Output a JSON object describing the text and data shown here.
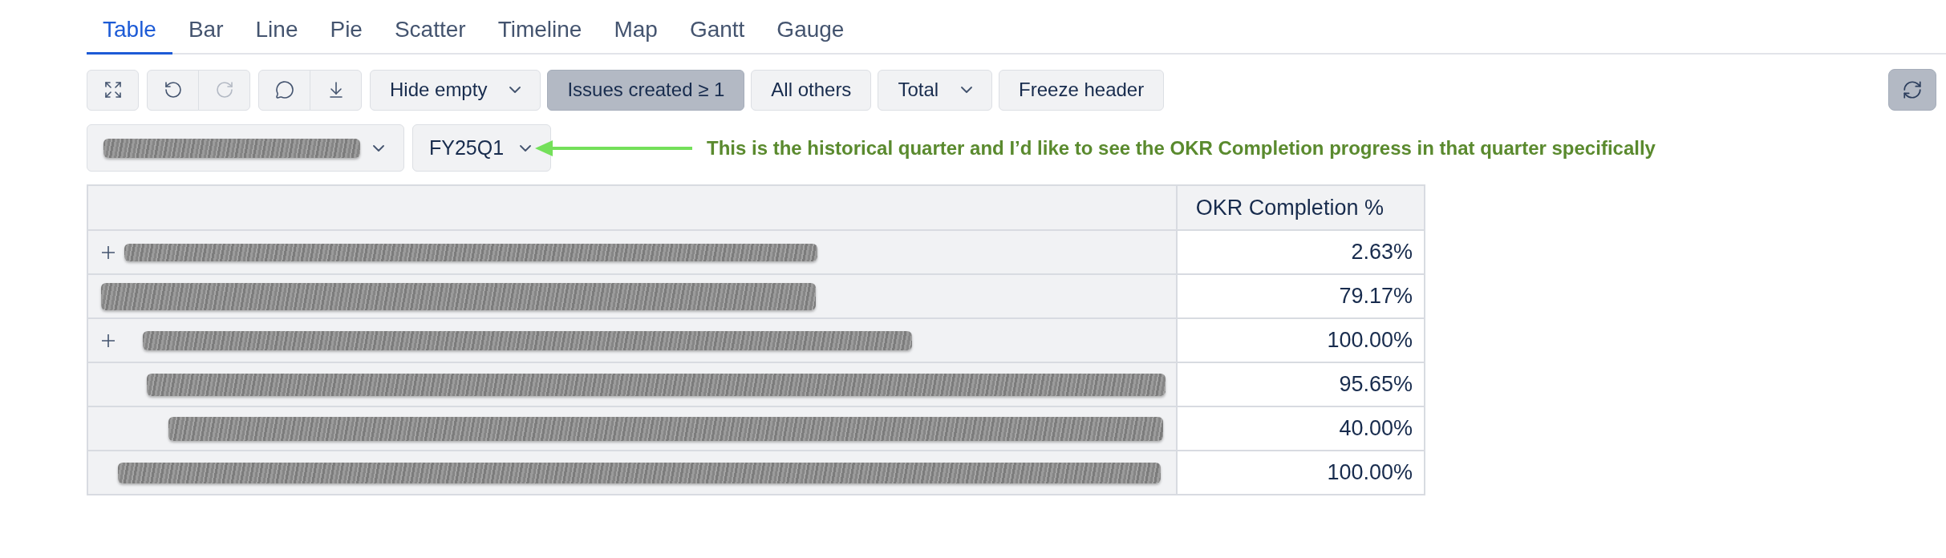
{
  "tabs": [
    {
      "label": "Table",
      "selected": true
    },
    {
      "label": "Bar",
      "selected": false
    },
    {
      "label": "Line",
      "selected": false
    },
    {
      "label": "Pie",
      "selected": false
    },
    {
      "label": "Scatter",
      "selected": false
    },
    {
      "label": "Timeline",
      "selected": false
    },
    {
      "label": "Map",
      "selected": false
    },
    {
      "label": "Gantt",
      "selected": false
    },
    {
      "label": "Gauge",
      "selected": false
    }
  ],
  "toolbar": {
    "icon_groups": [
      [
        {
          "kind": "expand",
          "disabled": false
        }
      ],
      [
        {
          "kind": "undo",
          "disabled": false
        },
        {
          "kind": "redo",
          "disabled": true
        }
      ],
      [
        {
          "kind": "comment",
          "disabled": false
        },
        {
          "kind": "download",
          "disabled": false
        }
      ]
    ],
    "options": [
      {
        "kind": "dropdown",
        "label": "Hide empty",
        "selected": false
      },
      {
        "kind": "toggle",
        "label": "Issues created ≥ 1",
        "selected": true
      },
      {
        "kind": "toggle",
        "label": "All others",
        "selected": false
      },
      {
        "kind": "dropdown",
        "label": "Total",
        "selected": false
      },
      {
        "kind": "toggle",
        "label": "Freeze header",
        "selected": false
      }
    ],
    "refresh": {
      "selected": true
    }
  },
  "filters": [
    {
      "kind": "redacted"
    },
    {
      "kind": "select",
      "value": "FY25Q1"
    }
  ],
  "annotation": {
    "text": "This is the historical quarter and I’d like to see the OKR Completion progress in that quarter specifically"
  },
  "table": {
    "value_column": "OKR Completion %",
    "rows": [
      {
        "expandable": true,
        "value": "2.63%"
      },
      {
        "expandable": false,
        "value": "79.17%"
      },
      {
        "expandable": true,
        "value": "100.00%"
      },
      {
        "expandable": false,
        "value": "95.65%"
      },
      {
        "expandable": false,
        "value": "40.00%"
      },
      {
        "expandable": false,
        "value": "100.00%"
      }
    ]
  }
}
